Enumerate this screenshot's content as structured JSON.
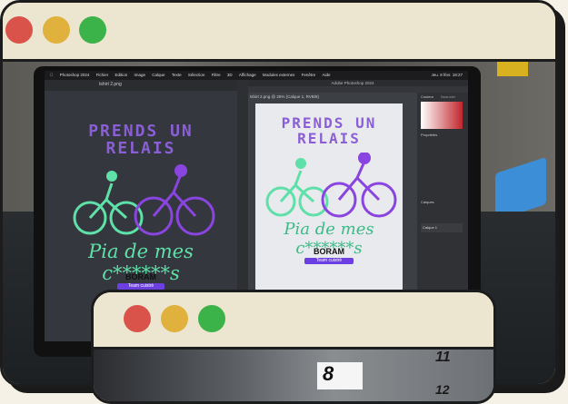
{
  "window_controls": {
    "close_color": "#d9534a",
    "minimize_color": "#e0b13d",
    "maximize_color": "#3bb349"
  },
  "screen": {
    "menubar": {
      "items": [
        "Photoshop 2024",
        "Fichier",
        "Edition",
        "Image",
        "Calque",
        "Texte",
        "Sélection",
        "Filtre",
        "3D",
        "Affichage",
        "Modules externes",
        "Fenêtre",
        "Aide"
      ],
      "clock": "Jeu. 8 févr. 18:27"
    },
    "ps_title": "Adobe Photoshop 2024",
    "left_file": "tshirt 2.png",
    "doc_tab": "tshirt 2.png @ 25% (Calque 1, RVB/8)",
    "artwork": {
      "line1": "PRENDS UN",
      "line2": "RELAIS",
      "tagline": "Pia de mes c******s",
      "brand": "BORAM",
      "brand_sub": "Team cuistrè"
    },
    "panels": [
      "Couleur",
      "Nuancier",
      "Propriétés",
      "Calques",
      "Calque 1"
    ]
  },
  "second_window": {
    "price_labels": [
      "8",
      "11",
      "12"
    ]
  }
}
